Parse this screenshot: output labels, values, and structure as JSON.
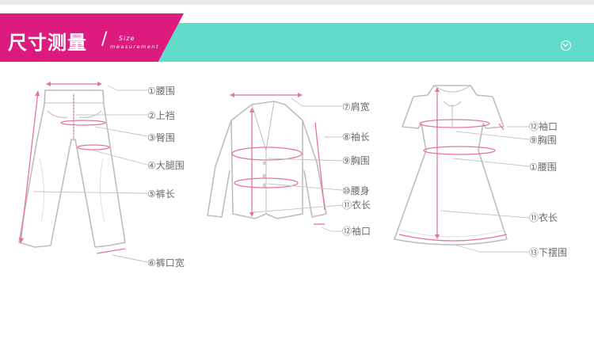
{
  "banner": {
    "title": "尺寸测量",
    "slash": "/",
    "subtitle_line1": "Size",
    "subtitle_line2": "measurement"
  },
  "colors": {
    "brand_pink": "#dd1a7d",
    "accent_teal": "#62dcca",
    "measure_line": "#e4759e",
    "label_text": "#6a6a6a"
  },
  "pants_labels": [
    "①腰围",
    "②上裆",
    "③臀围",
    "④大腿围",
    "⑤裤长",
    "⑥裤口宽"
  ],
  "jacket_labels": [
    "⑦肩宽",
    "⑧袖长",
    "⑨胸围",
    "⑩腰身",
    "⑪衣长",
    "⑫袖口"
  ],
  "dress_labels": [
    "⑫袖口",
    "⑨胸围",
    "①腰围",
    "⑪衣长",
    "⑬下摆围"
  ]
}
